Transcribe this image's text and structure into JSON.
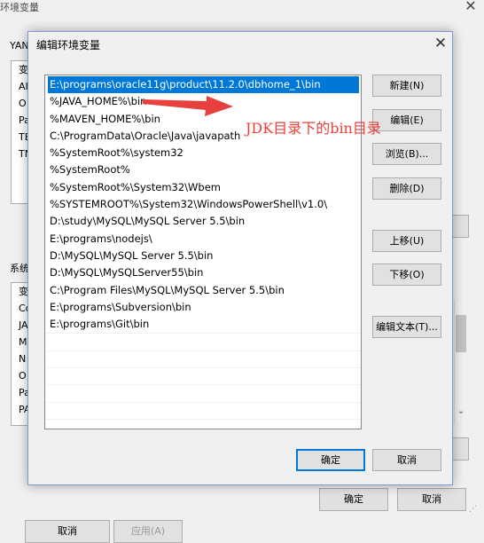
{
  "background_window": {
    "title": "环境变量",
    "user_label_fragment": "YAN",
    "user_list_header": "变",
    "user_list_fragments": [
      "AI",
      "O",
      "Pa",
      "TE",
      "TN"
    ],
    "system_label": "系统",
    "system_list_header": "变",
    "system_list_fragments": [
      "Co",
      "JA",
      "M",
      "N",
      "O",
      "Pa",
      "PA"
    ],
    "ok_label": "确定",
    "cancel_label": "取消",
    "bottom_left_label": "取消",
    "bottom_mid_label": "应用(A)"
  },
  "dialog": {
    "title": "编辑环境变量",
    "paths": [
      "E:\\programs\\oracle11g\\product\\11.2.0\\dbhome_1\\bin",
      "%JAVA_HOME%\\bin",
      "%MAVEN_HOME%\\bin",
      "C:\\ProgramData\\Oracle\\Java\\javapath",
      "%SystemRoot%\\system32",
      "%SystemRoot%",
      "%SystemRoot%\\System32\\Wbem",
      "%SYSTEMROOT%\\System32\\WindowsPowerShell\\v1.0\\",
      "D:\\study\\MySQL\\MySQL Server 5.5\\bin",
      "E:\\programs\\nodejs\\",
      "D:\\MySQL\\MySQL Server 5.5\\bin",
      "D:\\MySQL\\MySQLServer55\\bin",
      "C:\\Program Files\\MySQL\\MySQL Server 5.5\\bin",
      "E:\\programs\\Subversion\\bin",
      "E:\\programs\\Git\\bin"
    ],
    "buttons": {
      "new": "新建(N)",
      "edit": "编辑(E)",
      "browse": "浏览(B)...",
      "delete": "删除(D)",
      "move_up": "上移(U)",
      "move_down": "下移(O)",
      "edit_text": "编辑文本(T)...",
      "ok": "确定",
      "cancel": "取消"
    }
  },
  "annotation": {
    "text": "JDK目录下的bin目录",
    "color": "#e8403c"
  },
  "colors": {
    "selection": "#0078d7",
    "button_face": "#e1e1e1"
  }
}
